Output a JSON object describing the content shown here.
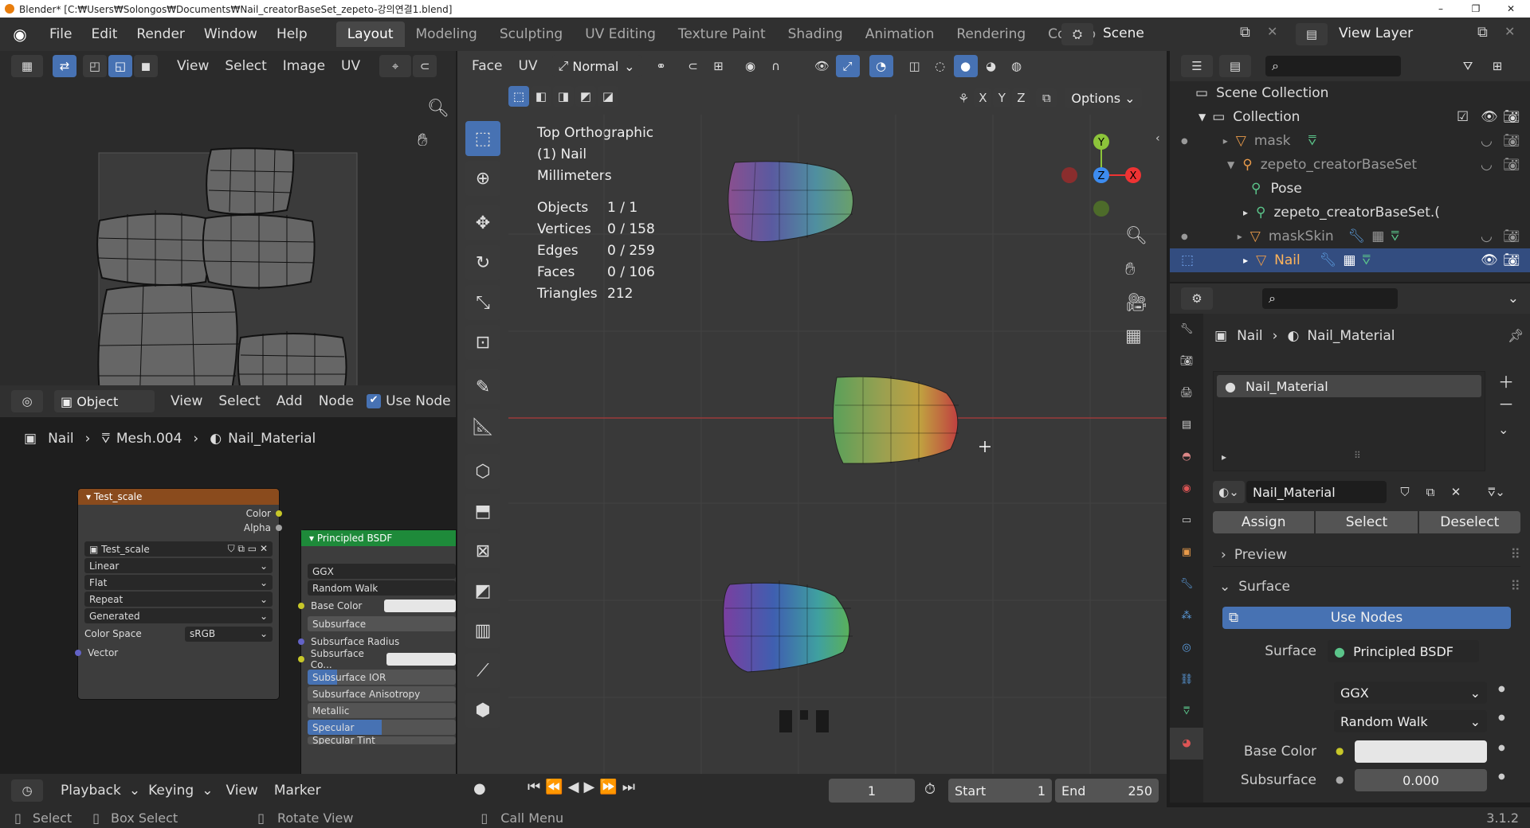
{
  "titlebar": {
    "title": "Blender* [C:₩Users₩Solongos₩Documents₩Nail_creatorBaseSet_zepeto-강의연결1.blend]",
    "minimize": "–",
    "maximize": "❐",
    "close": "✕"
  },
  "menus": [
    "File",
    "Edit",
    "Render",
    "Window",
    "Help"
  ],
  "workspaces": [
    "Layout",
    "Modeling",
    "Sculpting",
    "UV Editing",
    "Texture Paint",
    "Shading",
    "Animation",
    "Rendering",
    "Compo"
  ],
  "scene": {
    "label": "Scene",
    "view_layer": "View Layer"
  },
  "uv_editor": {
    "menu": [
      "View",
      "Select",
      "Image",
      "UV"
    ]
  },
  "node_editor": {
    "type": "Object",
    "menu": [
      "View",
      "Select",
      "Add",
      "Node"
    ],
    "use_nodes": "Use Node",
    "breadcrumb": [
      "Nail",
      "Mesh.004",
      "Nail_Material"
    ],
    "tex_node": {
      "title": "Test_scale",
      "out_color": "Color",
      "out_alpha": "Alpha",
      "image": "Test_scale",
      "interp": "Linear",
      "proj": "Flat",
      "ext": "Repeat",
      "source": "Generated",
      "cs_label": "Color Space",
      "cs_value": "sRGB",
      "in_vector": "Vector"
    },
    "bsdf_node": {
      "title": "Principled BSDF",
      "dist": "GGX",
      "sss": "Random Walk",
      "rows": [
        "Base Color",
        "Subsurface",
        "Subsurface Radius",
        "Subsurface Co...",
        "Subsurface IOR",
        "Subsurface Anisotropy",
        "Metallic",
        "Specular",
        "Specular Tint"
      ]
    }
  },
  "viewport": {
    "mode": "Face",
    "menu2": "UV",
    "orientation": "Normal",
    "options": "Options",
    "axes": [
      "X",
      "Y",
      "Z"
    ],
    "overlay_title": "Top Orthographic",
    "overlay_obj": "(1) Nail",
    "overlay_units": "Millimeters",
    "stats": [
      {
        "k": "Objects",
        "v": "1 / 1"
      },
      {
        "k": "Vertices",
        "v": "0 / 158"
      },
      {
        "k": "Edges",
        "v": "0 / 259"
      },
      {
        "k": "Faces",
        "v": "0 / 106"
      },
      {
        "k": "Triangles",
        "v": "212"
      }
    ],
    "gizmo": {
      "y": "Y",
      "z": "Z",
      "x": "X"
    }
  },
  "timeline": {
    "menu": [
      "Playback",
      "Keying",
      "View",
      "Marker"
    ],
    "frame": "1",
    "start_label": "Start",
    "start": "1",
    "end_label": "End",
    "end": "250"
  },
  "outliner": {
    "items": [
      {
        "label": "Scene Collection",
        "indent": 0
      },
      {
        "label": "Collection",
        "indent": 1
      },
      {
        "label": "mask",
        "indent": 2
      },
      {
        "label": "zepeto_creatorBaseSet",
        "indent": 2
      },
      {
        "label": "Pose",
        "indent": 3
      },
      {
        "label": "zepeto_creatorBaseSet.(",
        "indent": 3
      },
      {
        "label": "maskSkin",
        "indent": 2
      },
      {
        "label": "Nail",
        "indent": 2
      }
    ]
  },
  "properties": {
    "breadcrumb_obj": "Nail",
    "breadcrumb_mat": "Nail_Material",
    "slot": "Nail_Material",
    "material": "Nail_Material",
    "assign": "Assign",
    "select": "Select",
    "deselect": "Deselect",
    "preview": "Preview",
    "surface": "Surface",
    "use_nodes": "Use Nodes",
    "surface_label": "Surface",
    "surface_value": "Principled BSDF",
    "dist": "GGX",
    "sss": "Random Walk",
    "base_color": "Base Color",
    "subsurface": "Subsurface",
    "subsurface_val": "0.000"
  },
  "statusbar": {
    "select": "Select",
    "box_select": "Box Select",
    "rotate": "Rotate View",
    "call_menu": "Call Menu",
    "version": "3.1.2"
  }
}
